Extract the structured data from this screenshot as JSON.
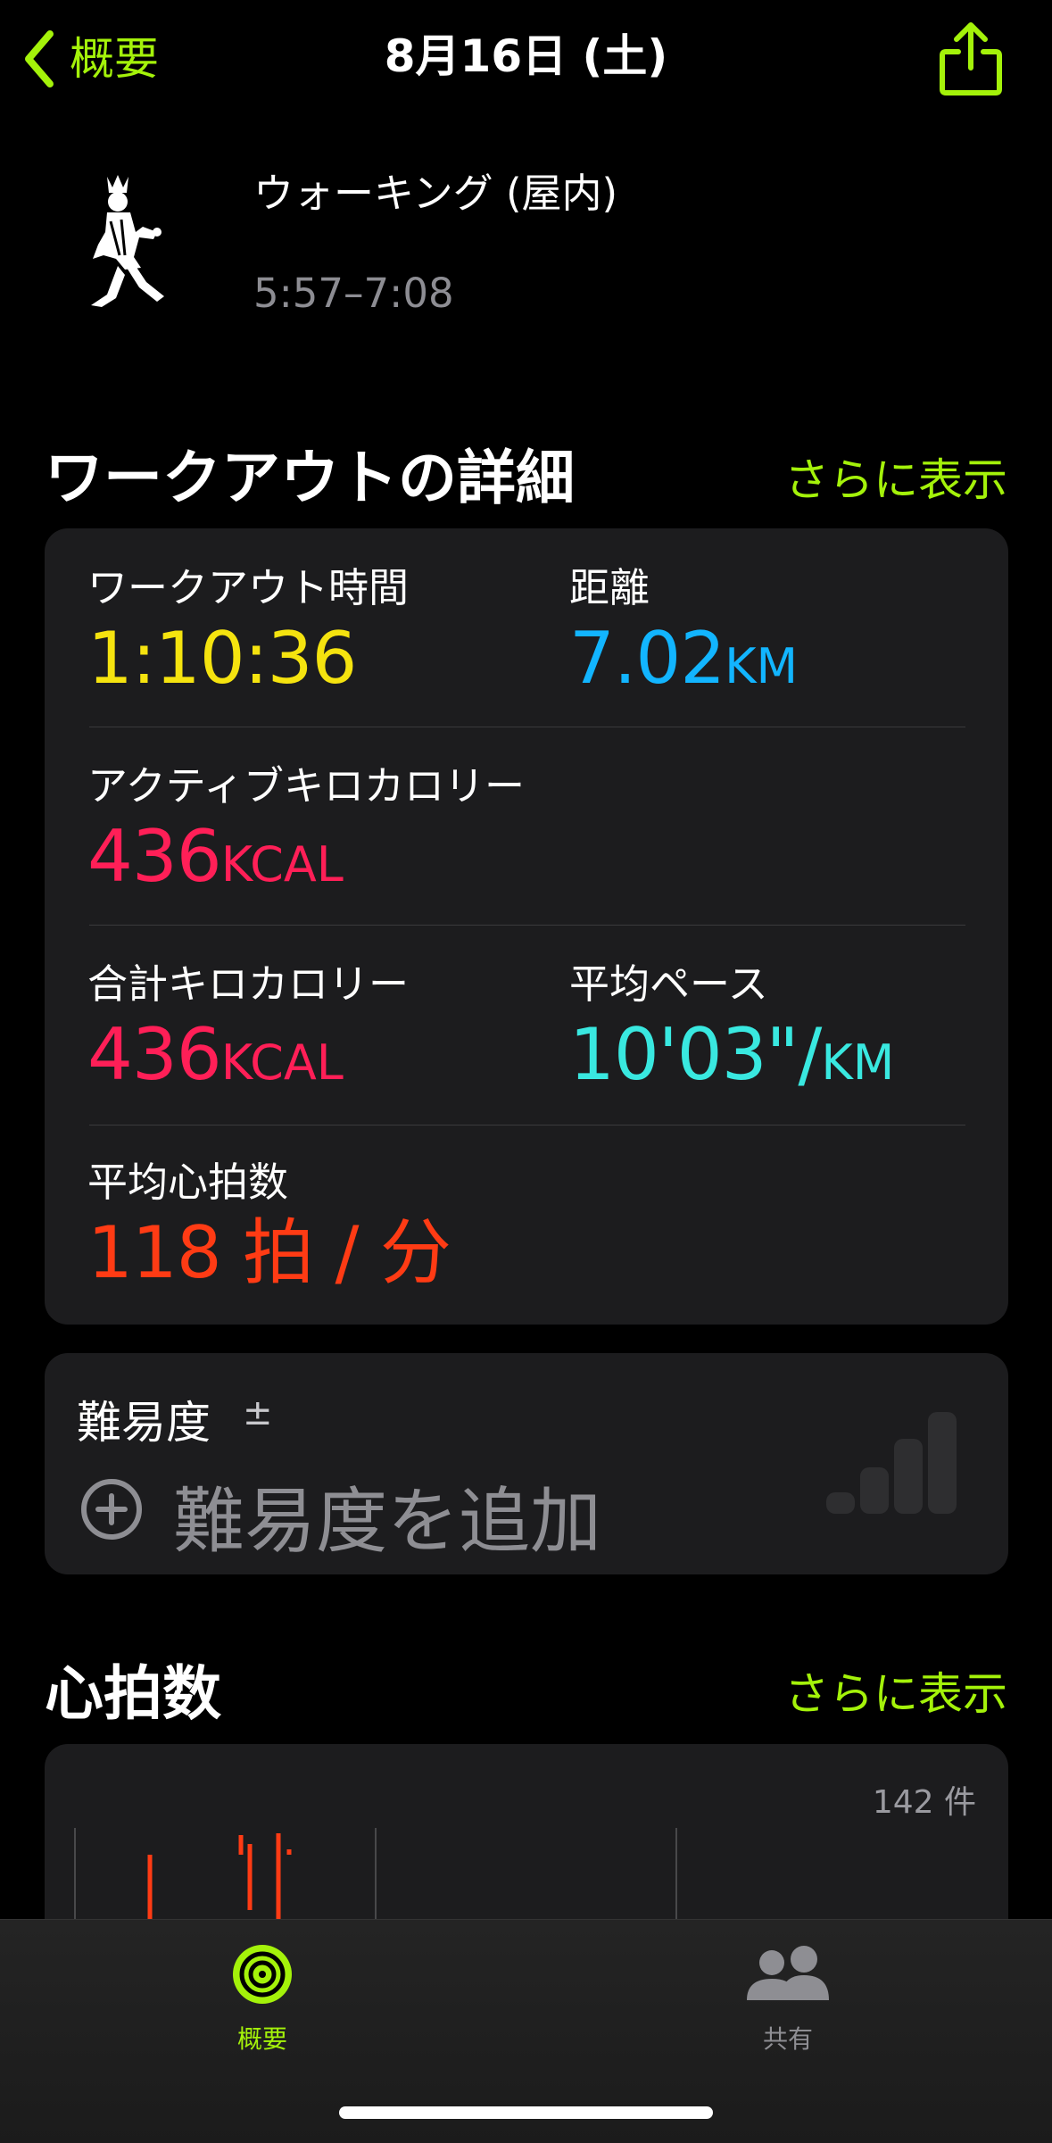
{
  "nav": {
    "back_label": "概要",
    "title": "8月16日 (土)",
    "share_icon": "share-icon",
    "accent": "#a4f20a"
  },
  "workout": {
    "name": "ウォーキング (屋内)",
    "time_range": "5:57–7:08",
    "icon": "walking-figure-icon"
  },
  "details": {
    "title": "ワークアウトの詳細",
    "more": "さらに表示",
    "duration_label": "ワークアウト時間",
    "duration_value": "1:10:36",
    "distance_label": "距離",
    "distance_value": "7.02",
    "distance_unit": "KM",
    "active_label": "アクティブキロカロリー",
    "active_value": "436",
    "active_unit": "KCAL",
    "total_label": "合計キロカロリー",
    "total_value": "436",
    "total_unit": "KCAL",
    "pace_label": "平均ペース",
    "pace_value": "10'03\"/",
    "pace_unit": "KM",
    "hr_label": "平均心拍数",
    "hr_value": "118 拍 / 分"
  },
  "difficulty": {
    "label": "難易度",
    "plusminus": "±",
    "add_label": "難易度を追加"
  },
  "heart_rate": {
    "title": "心拍数",
    "more": "さらに表示",
    "count": "142 件"
  },
  "tabs": [
    {
      "label": "概要",
      "icon": "activity-rings-icon",
      "selected": true
    },
    {
      "label": "共有",
      "icon": "people-icon",
      "selected": false
    }
  ],
  "colors": {
    "duration": "#f5e30f",
    "distance": "#12b5ff",
    "calories": "#ff1f57",
    "pace": "#39e8e0",
    "heart_rate": "#ff3b14"
  }
}
